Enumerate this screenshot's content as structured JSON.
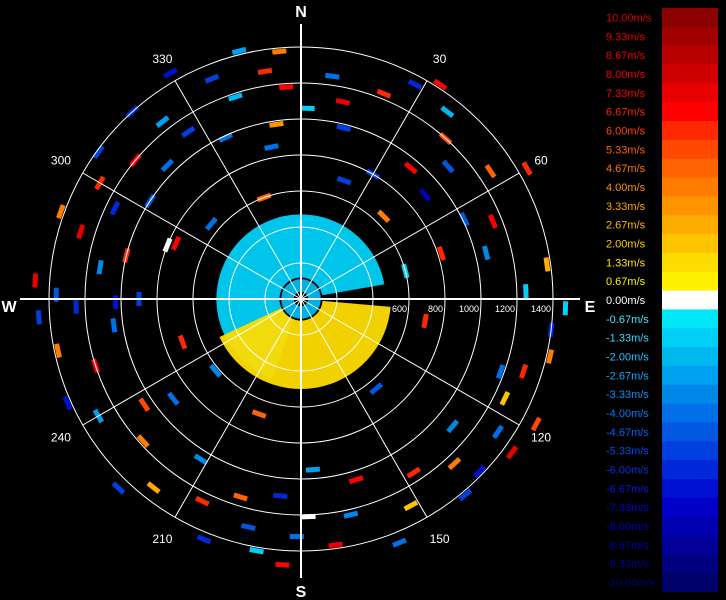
{
  "chart_data": {
    "type": "polar-scatter",
    "title": "",
    "units": "m/s",
    "compass": {
      "north": "N",
      "east": "E",
      "south": "S",
      "west": "W"
    },
    "azimuth_labels": [
      "30",
      "60",
      "120",
      "150",
      "210",
      "240",
      "300",
      "330"
    ],
    "azimuths_deg": [
      30,
      60,
      120,
      150,
      210,
      240,
      300,
      330
    ],
    "range_rings": [
      200,
      400,
      600,
      800,
      1000,
      1200,
      1400
    ],
    "range_labels": [
      "600",
      "800",
      "1000",
      "1200",
      "1400"
    ],
    "range_label_values": [
      600,
      800,
      1000,
      1200,
      1400
    ],
    "range_max": 1400,
    "colorscale": {
      "labels": [
        "10.00m/s",
        "9.33m/s",
        "8.67m/s",
        "8.00m/s",
        "7.33m/s",
        "6.67m/s",
        "6.00m/s",
        "5.33m/s",
        "4.67m/s",
        "4.00m/s",
        "3.33m/s",
        "2.67m/s",
        "2.00m/s",
        "1.33m/s",
        "0.67m/s",
        "0.00m/s",
        "-0.67m/s",
        "-1.33m/s",
        "-2.00m/s",
        "-2.67m/s",
        "-3.33m/s",
        "-4.00m/s",
        "-4.67m/s",
        "-5.33m/s",
        "-6.00m/s",
        "-6.67m/s",
        "-7.33m/s",
        "-8.00m/s",
        "-8.67m/s",
        "-9.33m/s",
        "-10.00m/s"
      ],
      "colors": [
        "#8b0000",
        "#a00000",
        "#b80000",
        "#d00000",
        "#e80000",
        "#ff0000",
        "#ff2800",
        "#ff4800",
        "#ff6400",
        "#ff7c00",
        "#ff9400",
        "#ffac00",
        "#ffc400",
        "#ffdc00",
        "#fff000",
        "#ffffff",
        "#00e8f8",
        "#00d0f8",
        "#00b8f0",
        "#00a0f0",
        "#0088e8",
        "#0070e8",
        "#0058e0",
        "#0040e0",
        "#0028d8",
        "#0010d0",
        "#0000c8",
        "#0000b0",
        "#000098",
        "#000080",
        "#000068"
      ],
      "text_colors": [
        "#d80000",
        "#e00000",
        "#e80000",
        "#f00000",
        "#f80000",
        "#ff2000",
        "#ff4400",
        "#ff6000",
        "#ff7800",
        "#ff9000",
        "#ffa400",
        "#ffb800",
        "#ffcc00",
        "#ffe000",
        "#fff000",
        "#ffffff",
        "#40e8ff",
        "#30d8ff",
        "#20c0ff",
        "#10a8ff",
        "#0890ff",
        "#0078ff",
        "#0060f8",
        "#0048f0",
        "#0030e8",
        "#0018e0",
        "#0000d8",
        "#0000c0",
        "#0000a8",
        "#000090",
        "#000078"
      ]
    },
    "gates": [
      {
        "az": 355,
        "r": 1380,
        "v": 4.0
      },
      {
        "az": 356,
        "r": 1180,
        "v": 6.7
      },
      {
        "az": 2,
        "r": 1060,
        "v": -1.3
      },
      {
        "az": 352,
        "r": 980,
        "v": 3.3
      },
      {
        "az": 8,
        "r": 1250,
        "v": -4.0
      },
      {
        "az": 12,
        "r": 1120,
        "v": 7.3
      },
      {
        "az": 14,
        "r": 980,
        "v": -5.3
      },
      {
        "az": 22,
        "r": 1230,
        "v": 6.0
      },
      {
        "az": 28,
        "r": 1350,
        "v": -6.0
      },
      {
        "az": 33,
        "r": 1420,
        "v": 6.7
      },
      {
        "az": 38,
        "r": 1320,
        "v": -2.0
      },
      {
        "az": 42,
        "r": 1200,
        "v": 5.3
      },
      {
        "az": 48,
        "r": 1100,
        "v": -4.7
      },
      {
        "az": 40,
        "r": 950,
        "v": 6.7
      },
      {
        "az": 30,
        "r": 800,
        "v": -5.3
      },
      {
        "az": 50,
        "r": 900,
        "v": -8.0
      },
      {
        "az": 56,
        "r": 1270,
        "v": 4.7
      },
      {
        "az": 60,
        "r": 1450,
        "v": 6.0
      },
      {
        "az": 64,
        "r": 1010,
        "v": -4.7
      },
      {
        "az": 68,
        "r": 1150,
        "v": 6.7
      },
      {
        "az": 72,
        "r": 820,
        "v": 6.0
      },
      {
        "az": 76,
        "r": 1060,
        "v": -3.3
      },
      {
        "az": 82,
        "r": 1380,
        "v": 2.7
      },
      {
        "az": 88,
        "r": 1250,
        "v": -1.3
      },
      {
        "az": 92,
        "r": 1470,
        "v": -1.3
      },
      {
        "az": 97,
        "r": 1400,
        "v": -6.0
      },
      {
        "az": 103,
        "r": 1420,
        "v": 4.0
      },
      {
        "az": 108,
        "r": 1300,
        "v": 6.0
      },
      {
        "az": 110,
        "r": 1180,
        "v": -4.0
      },
      {
        "az": 116,
        "r": 1260,
        "v": 2.0
      },
      {
        "az": 118,
        "r": 1480,
        "v": 5.3
      },
      {
        "az": 124,
        "r": 1320,
        "v": -4.0
      },
      {
        "az": 126,
        "r": 1450,
        "v": 7.3
      },
      {
        "az": 130,
        "r": 1100,
        "v": -3.3
      },
      {
        "az": 134,
        "r": 1380,
        "v": -6.7
      },
      {
        "az": 137,
        "r": 1250,
        "v": 4.0
      },
      {
        "az": 140,
        "r": 1420,
        "v": -5.3
      },
      {
        "az": 147,
        "r": 1150,
        "v": 6.0
      },
      {
        "az": 152,
        "r": 1300,
        "v": 2.0
      },
      {
        "az": 158,
        "r": 1460,
        "v": -4.0
      },
      {
        "az": 163,
        "r": 1050,
        "v": 6.7
      },
      {
        "az": 167,
        "r": 1230,
        "v": -3.3
      },
      {
        "az": 172,
        "r": 1380,
        "v": 7.3
      },
      {
        "az": 176,
        "r": 950,
        "v": -2.7
      },
      {
        "az": 178,
        "r": 1210,
        "v": 0.0
      },
      {
        "az": 181,
        "r": 1320,
        "v": -4.0
      },
      {
        "az": 184,
        "r": 1480,
        "v": 6.7
      },
      {
        "az": 186,
        "r": 1100,
        "v": -6.0
      },
      {
        "az": 190,
        "r": 1420,
        "v": -1.3
      },
      {
        "az": 193,
        "r": 1300,
        "v": -4.7
      },
      {
        "az": 197,
        "r": 1150,
        "v": 4.7
      },
      {
        "az": 202,
        "r": 1440,
        "v": -6.0
      },
      {
        "az": 206,
        "r": 1250,
        "v": 6.0
      },
      {
        "az": 212,
        "r": 1050,
        "v": -3.3
      },
      {
        "az": 218,
        "r": 1330,
        "v": 2.7
      },
      {
        "az": 224,
        "r": 1460,
        "v": -5.3
      },
      {
        "az": 228,
        "r": 1180,
        "v": 4.0
      },
      {
        "az": 232,
        "r": 900,
        "v": -4.0
      },
      {
        "az": 236,
        "r": 1050,
        "v": 5.3
      },
      {
        "az": 240,
        "r": 1300,
        "v": -2.7
      },
      {
        "az": 246,
        "r": 1420,
        "v": -6.7
      },
      {
        "az": 252,
        "r": 1200,
        "v": 6.7
      },
      {
        "az": 258,
        "r": 1380,
        "v": 4.0
      },
      {
        "az": 262,
        "r": 1050,
        "v": -4.0
      },
      {
        "az": 266,
        "r": 1460,
        "v": -5.3
      },
      {
        "az": 268,
        "r": 1250,
        "v": -6.0
      },
      {
        "az": 269,
        "r": 1030,
        "v": -6.7
      },
      {
        "az": 270,
        "r": 900,
        "v": -5.3
      },
      {
        "az": 271,
        "r": 1360,
        "v": -4.7
      },
      {
        "az": 274,
        "r": 1480,
        "v": 7.3
      },
      {
        "az": 279,
        "r": 1130,
        "v": -3.3
      },
      {
        "az": 284,
        "r": 1000,
        "v": 6.0
      },
      {
        "az": 287,
        "r": 1280,
        "v": 7.3
      },
      {
        "az": 290,
        "r": 1420,
        "v": 4.0
      },
      {
        "az": 292,
        "r": 800,
        "v": 0.0
      },
      {
        "az": 294,
        "r": 760,
        "v": 6.7
      },
      {
        "az": 296,
        "r": 1150,
        "v": -6.0
      },
      {
        "az": 300,
        "r": 1290,
        "v": 6.0
      },
      {
        "az": 303,
        "r": 1000,
        "v": -4.7
      },
      {
        "az": 306,
        "r": 1390,
        "v": -5.3
      },
      {
        "az": 310,
        "r": 1200,
        "v": 6.7
      },
      {
        "az": 315,
        "r": 1050,
        "v": -4.0
      },
      {
        "az": 318,
        "r": 1400,
        "v": -6.0
      },
      {
        "az": 322,
        "r": 1250,
        "v": -2.7
      },
      {
        "az": 326,
        "r": 1120,
        "v": -5.3
      },
      {
        "az": 330,
        "r": 1450,
        "v": -6.7
      },
      {
        "az": 335,
        "r": 990,
        "v": -4.0
      },
      {
        "az": 338,
        "r": 1320,
        "v": -5.3
      },
      {
        "az": 342,
        "r": 1180,
        "v": -2.0
      },
      {
        "az": 346,
        "r": 1420,
        "v": -2.7
      },
      {
        "az": 349,
        "r": 860,
        "v": -4.0
      },
      {
        "az": 351,
        "r": 1280,
        "v": 6.0
      },
      {
        "az": 20,
        "r": 700,
        "v": -5.3
      },
      {
        "az": 45,
        "r": 650,
        "v": 4.0
      },
      {
        "az": 75,
        "r": 600,
        "v": -1.3
      },
      {
        "az": 100,
        "r": 700,
        "v": 6.0
      },
      {
        "az": 140,
        "r": 650,
        "v": -4.7
      },
      {
        "az": 200,
        "r": 680,
        "v": 4.7
      },
      {
        "az": 230,
        "r": 620,
        "v": -3.3
      },
      {
        "az": 250,
        "r": 700,
        "v": 6.0
      },
      {
        "az": 310,
        "r": 650,
        "v": -4.0
      },
      {
        "az": 340,
        "r": 600,
        "v": 4.7
      }
    ],
    "echo_region": [
      {
        "v": -1.3,
        "az_start": 200,
        "az_end": 440,
        "r_inner": 120,
        "r_outer": 470
      },
      {
        "v": 1.3,
        "az_start": 95,
        "az_end": 245,
        "r_inner": 120,
        "r_outer": 500
      },
      {
        "v": -2.0,
        "az_start": 0,
        "az_end": 360,
        "r_inner": 40,
        "r_outer": 110
      }
    ]
  }
}
